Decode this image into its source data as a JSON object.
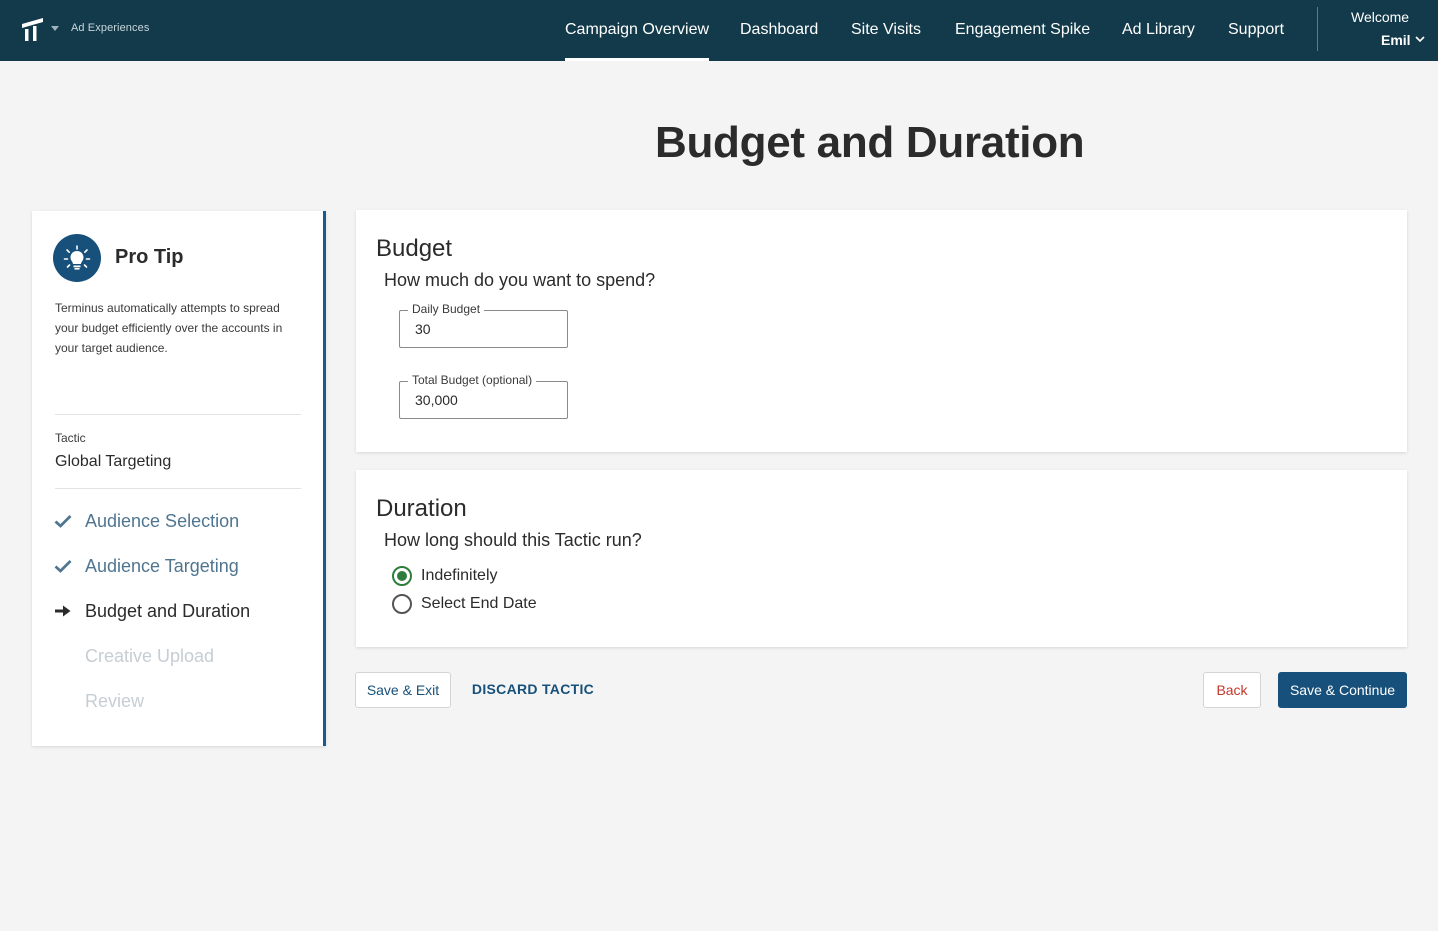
{
  "header": {
    "app_name": "Ad Experiences",
    "nav": [
      {
        "label": "Campaign Overview",
        "active": true
      },
      {
        "label": "Dashboard",
        "active": false
      },
      {
        "label": "Site Visits",
        "active": false
      },
      {
        "label": "Engagement Spike",
        "active": false
      },
      {
        "label": "Ad Library",
        "active": false
      },
      {
        "label": "Support",
        "active": false
      }
    ],
    "welcome": "Welcome",
    "user_name": "Emil"
  },
  "page_title": "Budget and Duration",
  "sidebar": {
    "tip_title": "Pro Tip",
    "tip_text": "Terminus automatically attempts to spread your budget efficiently over the accounts in your target audience.",
    "tactic_label": "Tactic",
    "tactic_value": "Global Targeting",
    "steps": [
      {
        "label": "Audience Selection",
        "status": "done"
      },
      {
        "label": "Audience Targeting",
        "status": "done"
      },
      {
        "label": "Budget and Duration",
        "status": "current"
      },
      {
        "label": "Creative Upload",
        "status": "todo"
      },
      {
        "label": "Review",
        "status": "todo"
      }
    ]
  },
  "budget": {
    "title": "Budget",
    "question": "How much do you want to spend?",
    "daily_label": "Daily Budget",
    "daily_value": "30",
    "total_label": "Total Budget (optional)",
    "total_value": "30,000"
  },
  "duration": {
    "title": "Duration",
    "question": "How long should this Tactic run?",
    "options": [
      {
        "label": "Indefinitely",
        "checked": true
      },
      {
        "label": "Select End Date",
        "checked": false
      }
    ]
  },
  "actions": {
    "save_exit": "Save & Exit",
    "discard": "DISCARD TACTIC",
    "back": "Back",
    "save_continue": "Save & Continue"
  },
  "colors": {
    "header_bg": "#123a4a",
    "primary": "#17507a",
    "radio_checked": "#2f7d3c",
    "back_text": "#c0392b"
  }
}
